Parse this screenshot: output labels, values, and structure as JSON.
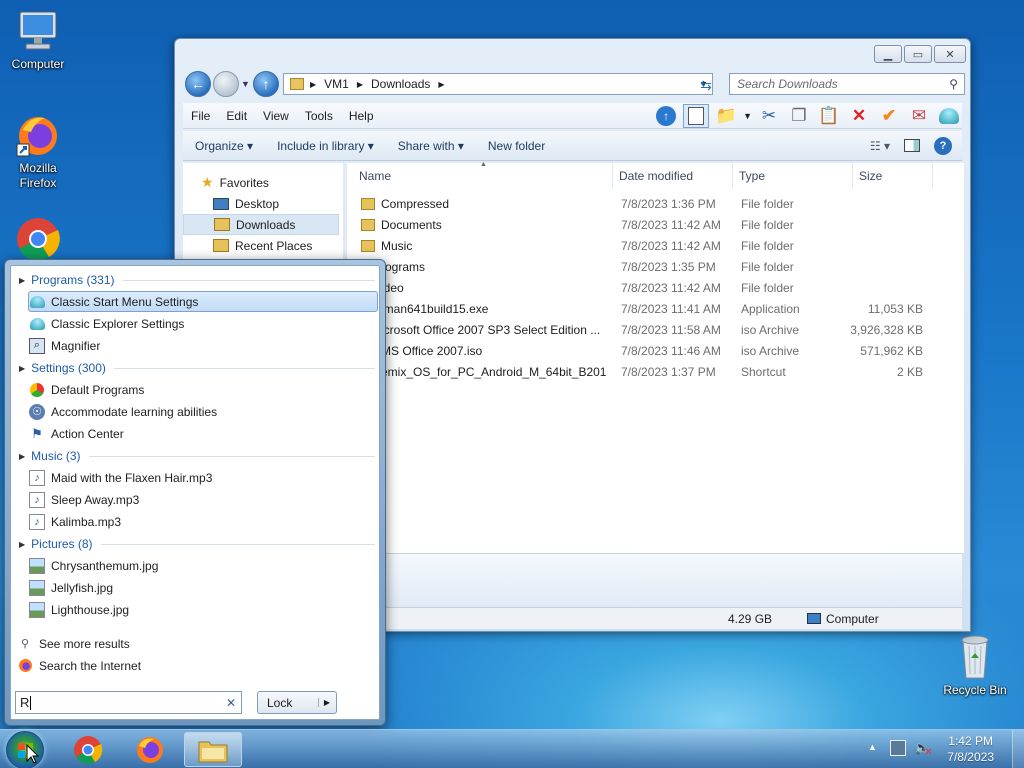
{
  "desktop": {
    "icons": [
      {
        "label": "Computer",
        "icon": "computer-icon"
      },
      {
        "label": "Mozilla Firefox",
        "icon": "firefox-icon"
      },
      {
        "label": "",
        "icon": "chrome-icon"
      },
      {
        "label": "Recycle Bin",
        "icon": "recycle-bin-icon"
      }
    ]
  },
  "explorer": {
    "address": {
      "crumbs": [
        "VM1",
        "Downloads"
      ]
    },
    "search_placeholder": "Search Downloads",
    "menu": [
      "File",
      "Edit",
      "View",
      "Tools",
      "Help"
    ],
    "commands": {
      "organize": "Organize",
      "include": "Include in library",
      "share": "Share with",
      "new_folder": "New folder"
    },
    "nav": {
      "favorites": "Favorites",
      "items": [
        "Desktop",
        "Downloads",
        "Recent Places"
      ],
      "selected": "Downloads"
    },
    "columns": {
      "name": "Name",
      "date": "Date modified",
      "type": "Type",
      "size": "Size"
    },
    "files": [
      {
        "name": "Compressed",
        "date": "7/8/2023 1:36 PM",
        "type": "File folder",
        "size": ""
      },
      {
        "name": "Documents",
        "date": "7/8/2023 11:42 AM",
        "type": "File folder",
        "size": ""
      },
      {
        "name": "Music",
        "date": "7/8/2023 11:42 AM",
        "type": "File folder",
        "size": ""
      },
      {
        "name": "rograms",
        "date": "7/8/2023 1:35 PM",
        "type": "File folder",
        "size": ""
      },
      {
        "name": "ideo",
        "date": "7/8/2023 11:42 AM",
        "type": "File folder",
        "size": ""
      },
      {
        "name": "lman641build15.exe",
        "date": "7/8/2023 11:41 AM",
        "type": "Application",
        "size": "11,053 KB"
      },
      {
        "name": "icrosoft Office 2007 SP3 Select Edition ...",
        "date": "7/8/2023 11:58 AM",
        "type": "iso Archive",
        "size": "3,926,328 KB"
      },
      {
        "name": "MS Office 2007.iso",
        "date": "7/8/2023 11:46 AM",
        "type": "iso Archive",
        "size": "571,962 KB"
      },
      {
        "name": "emix_OS_for_PC_Android_M_64bit_B201...",
        "date": "7/8/2023 1:37 PM",
        "type": "Shortcut",
        "size": "2 KB"
      }
    ],
    "status": {
      "size": "4.29 GB",
      "location": "Computer"
    }
  },
  "start_menu": {
    "groups": [
      {
        "header": "Programs (331)",
        "items": [
          {
            "label": "Classic Start Menu Settings",
            "selected": true,
            "icon": "shell-icon"
          },
          {
            "label": "Classic Explorer Settings",
            "icon": "shell-icon"
          },
          {
            "label": "Magnifier",
            "icon": "magnifier-icon"
          }
        ]
      },
      {
        "header": "Settings (300)",
        "items": [
          {
            "label": "Default Programs",
            "icon": "default-programs-icon"
          },
          {
            "label": "Accommodate learning abilities",
            "icon": "ease-of-access-icon"
          },
          {
            "label": "Action Center",
            "icon": "flag-icon"
          }
        ]
      },
      {
        "header": "Music (3)",
        "items": [
          {
            "label": "Maid with the Flaxen Hair.mp3",
            "icon": "music-file-icon"
          },
          {
            "label": "Sleep Away.mp3",
            "icon": "music-file-icon"
          },
          {
            "label": "Kalimba.mp3",
            "icon": "music-file-icon"
          }
        ]
      },
      {
        "header": "Pictures (8)",
        "items": [
          {
            "label": "Chrysanthemum.jpg",
            "icon": "image-file-icon"
          },
          {
            "label": "Jellyfish.jpg",
            "icon": "image-file-icon"
          },
          {
            "label": "Lighthouse.jpg",
            "icon": "image-file-icon"
          }
        ]
      }
    ],
    "see_more": "See more results",
    "search_internet": "Search the Internet",
    "search_value": "R",
    "lock_label": "Lock"
  },
  "taskbar": {
    "time": "1:42 PM",
    "date": "7/8/2023",
    "apps": [
      "chrome-icon",
      "firefox-icon",
      "explorer-icon"
    ]
  },
  "colors": {
    "accent": "#1e5aa8",
    "selection": "#cce8ff"
  }
}
